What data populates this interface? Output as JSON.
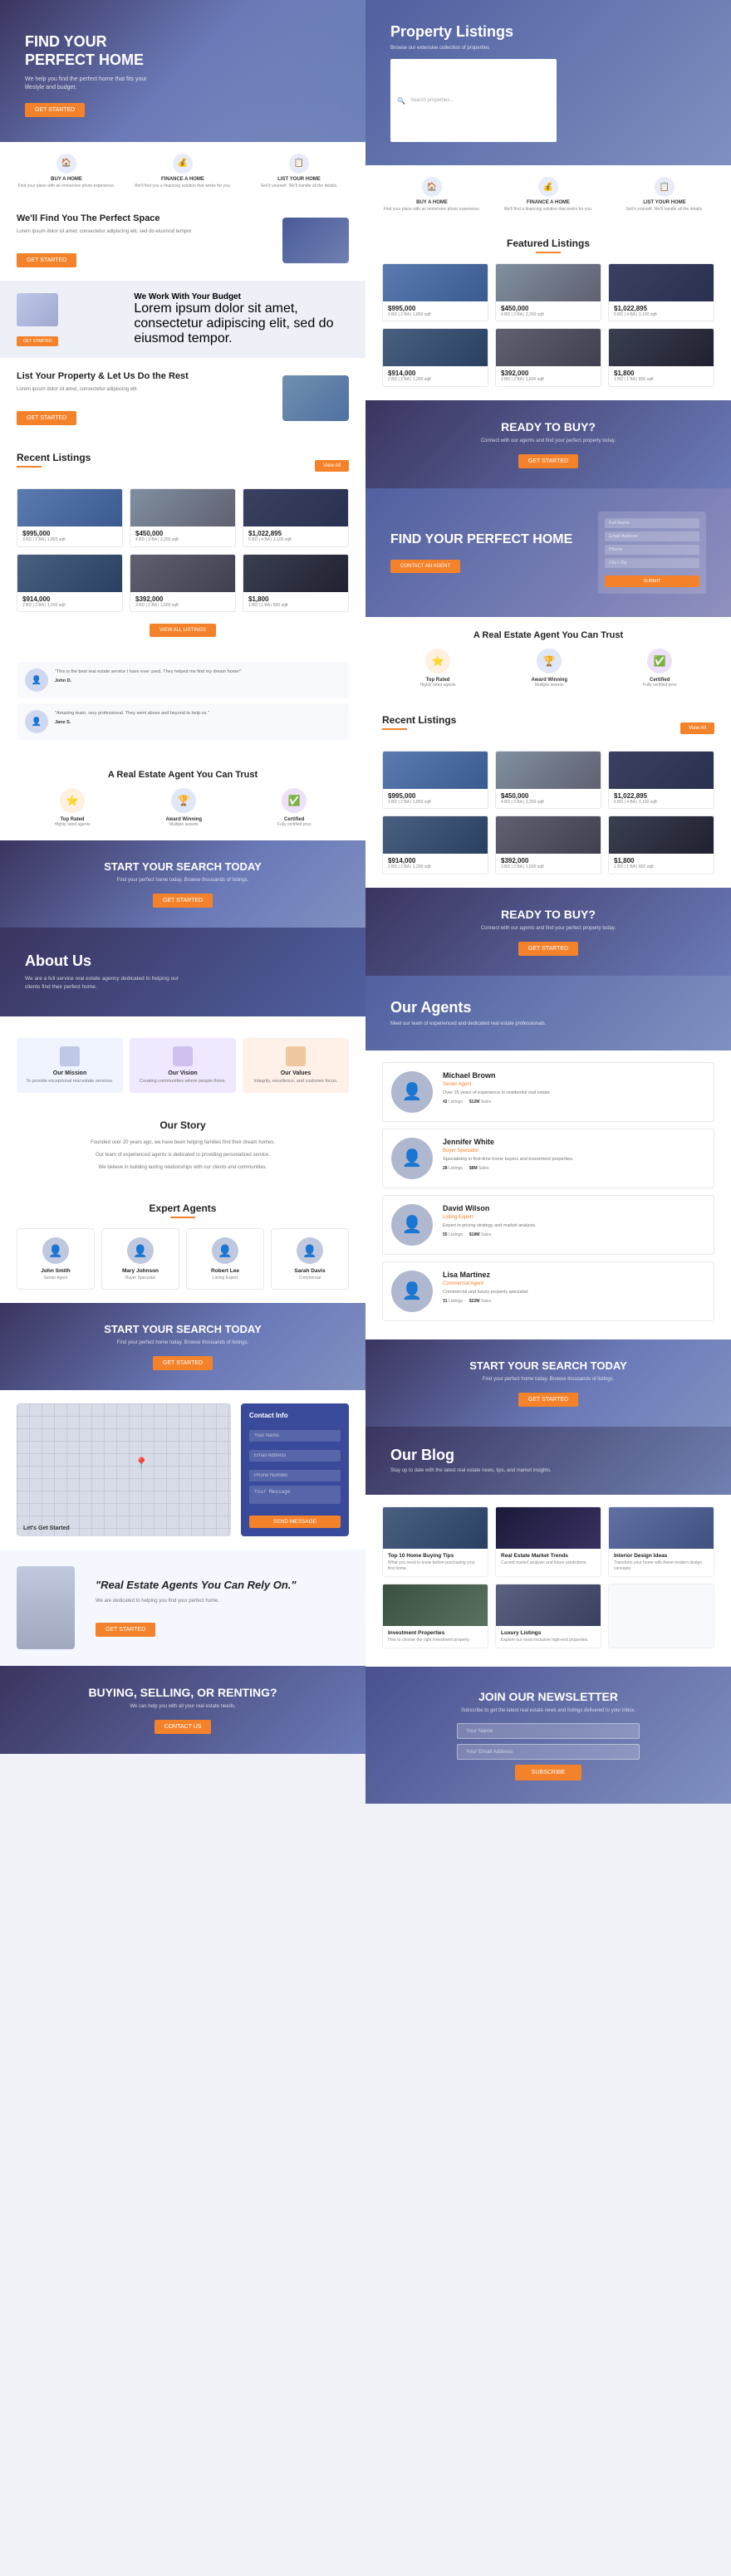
{
  "left_col": {
    "hero": {
      "title": "FIND YOUR\nPERFECT HOME",
      "subtitle": "We help you find the perfect home that fits your lifestyle and budget.",
      "cta": "GET STARTED"
    },
    "features": [
      {
        "icon": "🏠",
        "title": "BUY A HOME",
        "desc": "Find your place with an immersive photo experience."
      },
      {
        "icon": "💰",
        "title": "FINANCE A HOME",
        "desc": "We'll find you a financing solution that works for you."
      },
      {
        "icon": "📋",
        "title": "LIST YOUR HOME",
        "desc": "Sell it yourself. We'll handle all the details."
      }
    ],
    "find_space": {
      "title": "We'll Find You The\nPerfect Space",
      "desc": "Lorem ipsum dolor sit amet, consectetur adipiscing elit, sed do eiusmod tempor.",
      "cta": "GET STARTED"
    },
    "budget": {
      "title": "We Work With Your Budget",
      "desc": "Lorem ipsum dolor sit amet, consectetur adipiscing elit, sed do eiusmod tempor.",
      "cta": "GET STARTED"
    },
    "list_property": {
      "title": "List Your Property & Let Us Do the Rest",
      "desc": "Lorem ipsum dolor sit amet, consectetur adipiscing elit.",
      "cta": "GET STARTED"
    },
    "recent_listings": {
      "section_title": "Recent Listings",
      "view_all": "View All",
      "listings": [
        {
          "price": "$995,000",
          "desc": "3 BD | 2 BA | 1,850 sqft",
          "type": "blue"
        },
        {
          "price": "$450,000",
          "desc": "4 BD | 3 BA | 2,200 sqft",
          "type": "gray"
        },
        {
          "price": "$1,022,895",
          "desc": "5 BD | 4 BA | 3,100 sqft",
          "type": "dark"
        },
        {
          "price": "$914,000",
          "desc": "2 BD | 2 BA | 1,200 sqft",
          "type": "blue"
        },
        {
          "price": "$392,000",
          "desc": "3 BD | 2 BA | 1,600 sqft",
          "type": "gray"
        },
        {
          "price": "$1,800",
          "desc": "1 BD | 1 BA | 800 sqft",
          "type": "dark"
        }
      ]
    },
    "testimonials": [
      {
        "text": "\"This is the best real estate service I have ever used. They helped me find my dream home!\"",
        "author": "John D."
      },
      {
        "text": "\"Amazing team, very professional. They went above and beyond to help us.\"",
        "author": "Jane S."
      }
    ],
    "trust": {
      "title": "A Real Estate Agent You Can Trust",
      "items": [
        {
          "icon": "⭐",
          "color": "orange",
          "title": "Top Rated",
          "desc": "Highly rated agents"
        },
        {
          "icon": "🏆",
          "color": "blue",
          "title": "Award Winning",
          "desc": "Multiple awards"
        },
        {
          "icon": "✅",
          "color": "purple",
          "title": "Certified",
          "desc": "Fully certified pros"
        }
      ]
    },
    "cta1": {
      "title": "START YOUR SEARCH TODAY",
      "desc": "Find your perfect home today. Browse thousands of listings.",
      "cta": "GET STARTED"
    },
    "about_hero": {
      "title": "About Us",
      "desc": "We are a full service real estate agency dedicated to helping our clients find their perfect home."
    },
    "about_cards": [
      {
        "title": "Our Mission",
        "desc": "To provide exceptional real estate services."
      },
      {
        "title": "Our Vision",
        "desc": "Creating communities where people thrive."
      },
      {
        "title": "Our Values",
        "desc": "Integrity, excellence, and customer focus."
      }
    ],
    "our_story": {
      "title": "Our Story",
      "paragraphs": [
        "Founded over 20 years ago, we have been helping families find their dream homes.",
        "Our team of experienced agents is dedicated to providing personalized service.",
        "We believe in building lasting relationships with our clients and communities."
      ]
    },
    "agents": {
      "title": "Expert Agents",
      "items": [
        {
          "name": "John Smith",
          "title": "Senior Agent"
        },
        {
          "name": "Mary Johnson",
          "title": "Buyer Specialist"
        },
        {
          "name": "Robert Lee",
          "title": "Listing Expert"
        },
        {
          "name": "Sarah Davis",
          "title": "Commercial"
        }
      ]
    },
    "cta2": {
      "title": "START YOUR SEARCH TODAY",
      "desc": "Find your perfect home today. Browse thousands of listings.",
      "cta": "GET STARTED"
    },
    "contact": {
      "title": "Let's Get Started",
      "form_title": "Contact Info",
      "fields": [
        "Your Name",
        "Email Address",
        "Phone Number",
        "Your Message"
      ],
      "cta": "SEND MESSAGE"
    },
    "person_quote": {
      "quote": "\"Real Estate Agents You Can Rely On.\"",
      "subcopy": "We are dedicated to helping you find your perfect home.",
      "cta": "GET STARTED"
    },
    "buying_banner": {
      "title": "BUYING, SELLING, OR\nRENTING?",
      "desc": "We can help you with all your real estate needs.",
      "cta": "CONTACT US"
    }
  },
  "right_col": {
    "prop_hero": {
      "title": "Property Listings",
      "subtitle": "Browse our extensive collection of properties",
      "search_placeholder": "Search properties..."
    },
    "prop_features": [
      {
        "icon": "🏠",
        "title": "BUY A HOME",
        "desc": "Find your place with an immersive photo experience."
      },
      {
        "icon": "💰",
        "title": "FINANCE A HOME",
        "desc": "We'll find a financing solution that works for you."
      },
      {
        "icon": "📋",
        "title": "LIST YOUR HOME",
        "desc": "Sell it yourself. We'll handle all the details."
      }
    ],
    "featured": {
      "title": "Featured Listings",
      "listings": [
        {
          "price": "$995,000",
          "desc": "3 BD | 2 BA | 1,850 sqft",
          "type": "blue"
        },
        {
          "price": "$450,000",
          "desc": "4 BD | 3 BA | 2,200 sqft",
          "type": "gray"
        },
        {
          "price": "$1,022,895",
          "desc": "5 BD | 4 BA | 3,100 sqft",
          "type": "dark"
        },
        {
          "price": "$914,000",
          "desc": "2 BD | 2 BA | 1,200 sqft",
          "type": "blue"
        },
        {
          "price": "$392,000",
          "desc": "3 BD | 2 BA | 1,600 sqft",
          "type": "gray"
        },
        {
          "price": "$1,800",
          "desc": "1 BD | 1 BA | 800 sqft",
          "type": "dark"
        }
      ]
    },
    "ready": {
      "title": "READY TO BUY?",
      "desc": "Connect with our agents and find your perfect property today.",
      "cta": "GET STARTED"
    },
    "find_hero": {
      "title": "FIND YOUR\nPERFECT HOME",
      "form_fields": [
        "Full Name",
        "Email Address",
        "Phone",
        "City / Zip"
      ],
      "cta": "CONTACT AN AGENT"
    },
    "trust2": {
      "title": "A Real Estate Agent You Can Trust",
      "items": [
        {
          "icon": "⭐",
          "color": "orange",
          "title": "Top Rated",
          "desc": "Highly rated agents"
        },
        {
          "icon": "🏆",
          "color": "blue",
          "title": "Award Winning",
          "desc": "Multiple awards"
        },
        {
          "icon": "✅",
          "color": "purple",
          "title": "Certified",
          "desc": "Fully certified pros"
        }
      ]
    },
    "recent2": {
      "title": "Recent Listings",
      "view_all": "View All",
      "listings": [
        {
          "price": "$995,000",
          "desc": "3 BD | 2 BA | 1,850 sqft",
          "type": "blue"
        },
        {
          "price": "$450,000",
          "desc": "4 BD | 3 BA | 2,200 sqft",
          "type": "gray"
        },
        {
          "price": "$1,022,895",
          "desc": "5 BD | 4 BA | 3,100 sqft",
          "type": "dark"
        },
        {
          "price": "$914,000",
          "desc": "2 BD | 2 BA | 1,200 sqft",
          "type": "blue"
        },
        {
          "price": "$392,000",
          "desc": "3 BD | 2 BA | 1,600 sqft",
          "type": "gray"
        },
        {
          "price": "$1,800",
          "desc": "1 BD | 1 BA | 800 sqft",
          "type": "dark"
        }
      ]
    },
    "ready2": {
      "title": "READY TO BUY?",
      "desc": "Connect with our agents and find your perfect property today.",
      "cta": "GET STARTED"
    },
    "agents_page": {
      "hero_title": "Our Agents",
      "hero_desc": "Meet our team of experienced and dedicated real estate professionals.",
      "agents": [
        {
          "name": "Michael Brown",
          "title": "Senior Agent",
          "desc": "Over 15 years of experience in residential real estate.",
          "listings": "42",
          "sales": "$12M"
        },
        {
          "name": "Jennifer White",
          "title": "Buyer Specialist",
          "desc": "Specializing in first-time home buyers and investment properties.",
          "listings": "28",
          "sales": "$8M"
        },
        {
          "name": "David Wilson",
          "title": "Listing Expert",
          "desc": "Expert in pricing strategy and market analysis.",
          "listings": "55",
          "sales": "$18M"
        },
        {
          "name": "Lisa Martinez",
          "title": "Commercial Agent",
          "desc": "Commercial and luxury property specialist.",
          "listings": "31",
          "sales": "$22M"
        }
      ]
    },
    "cta_search": {
      "title": "START YOUR SEARCH TODAY",
      "desc": "Find your perfect home today. Browse thousands of listings.",
      "cta": "GET STARTED"
    },
    "blog": {
      "hero_title": "Our Blog",
      "hero_desc": "Stay up to date with the latest real estate news, tips, and market insights.",
      "posts": [
        {
          "title": "Top 10 Home Buying Tips",
          "desc": "What you need to know before purchasing your first home.",
          "type": "city"
        },
        {
          "title": "Real Estate Market Trends",
          "desc": "Current market analysis and future predictions.",
          "type": "night"
        },
        {
          "title": "Interior Design Ideas",
          "desc": "Transform your home with these modern design concepts.",
          "type": "arch"
        },
        {
          "title": "Investment Properties",
          "desc": "How to choose the right investment property.",
          "type": "park"
        },
        {
          "title": "Luxury Listings",
          "desc": "Explore our most exclusive high-end properties.",
          "type": "modern"
        }
      ]
    },
    "newsletter": {
      "title": "JOIN OUR NEWSLETTER",
      "desc": "Subscribe to get the latest real estate news and listings delivered to your inbox.",
      "email_placeholder": "Your Email Address",
      "name_placeholder": "Your Name",
      "cta": "SUBSCRIBE"
    }
  }
}
